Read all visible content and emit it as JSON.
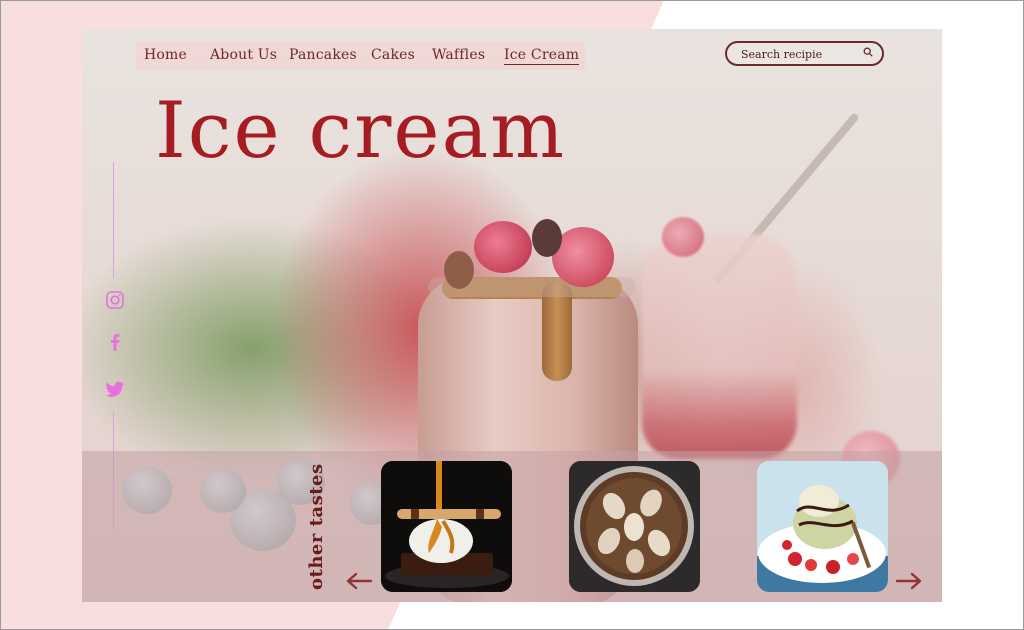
{
  "nav": {
    "items": [
      {
        "label": "Home"
      },
      {
        "label": "About Us"
      },
      {
        "label": "Pancakes"
      },
      {
        "label": "Cakes"
      },
      {
        "label": "Waffles"
      },
      {
        "label": "Ice Cream",
        "active": true
      }
    ]
  },
  "search": {
    "placeholder": "Search recipie",
    "icon": "search-icon"
  },
  "hero": {
    "title": "Ice cream"
  },
  "social": {
    "icons": [
      "instagram-icon",
      "facebook-icon",
      "twitter-icon"
    ],
    "color": "#e86fe0"
  },
  "gallery": {
    "label": "other tastes",
    "items": [
      "caramel-dessert",
      "coffee-cup",
      "ice-cream-plate"
    ],
    "prev_icon": "arrow-left-icon",
    "next_icon": "arrow-right-icon"
  },
  "colors": {
    "accent": "#a51d22",
    "text": "#6b2a2a",
    "background": "#f9dede"
  }
}
